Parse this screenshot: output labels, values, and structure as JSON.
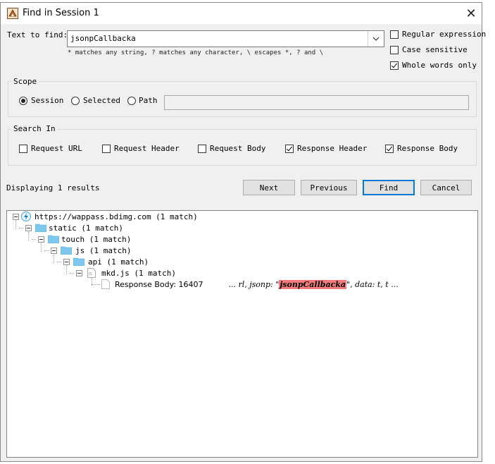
{
  "window": {
    "title": "Find in Session 1"
  },
  "search": {
    "label": "Text to find:",
    "value": "jsonpCallbacka",
    "hint": "* matches any string, ? matches any character, \\ escapes *, ? and \\"
  },
  "options": {
    "regex": {
      "label": "Regular expression",
      "checked": false
    },
    "case": {
      "label": "Case sensitive",
      "checked": false
    },
    "whole": {
      "label": "Whole words only",
      "checked": true
    }
  },
  "scope": {
    "title": "Scope",
    "session": "Session",
    "selected": "Selected",
    "path": "Path",
    "selected_value": "Session"
  },
  "search_in": {
    "title": "Search In",
    "request_url": {
      "label": "Request URL",
      "checked": false
    },
    "request_header": {
      "label": "Request Header",
      "checked": false
    },
    "request_body": {
      "label": "Request Body",
      "checked": false
    },
    "response_header": {
      "label": "Response Header",
      "checked": true
    },
    "response_body": {
      "label": "Response Body",
      "checked": true
    }
  },
  "status": "Displaying 1 results",
  "buttons": {
    "next": "Next",
    "previous": "Previous",
    "find": "Find",
    "cancel": "Cancel"
  },
  "tree": {
    "host": "https://wappass.bdimg.com (1 match)",
    "static": "static (1 match)",
    "touch": "touch (1 match)",
    "js": "js (1 match)",
    "api": "api (1 match)",
    "file": "mkd.js (1 match)",
    "result_label": "Response Body: 16407",
    "snippet_before": "...   rl, jsonp: \"",
    "snippet_match": "jsonpCallbacka",
    "snippet_after": "\", data: t, t   ..."
  },
  "colors": {
    "highlight": "#f47b7b",
    "focus": "#0078d7",
    "folder": "#7ec8f0"
  }
}
